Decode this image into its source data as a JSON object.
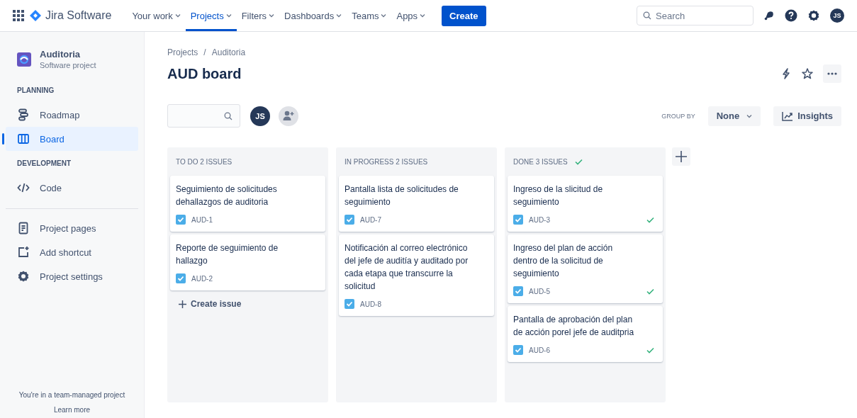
{
  "nav": {
    "app_name": "Jira Software",
    "items": [
      {
        "label": "Your work",
        "selected": false
      },
      {
        "label": "Projects",
        "selected": true
      },
      {
        "label": "Filters",
        "selected": false
      },
      {
        "label": "Dashboards",
        "selected": false
      },
      {
        "label": "Teams",
        "selected": false
      },
      {
        "label": "Apps",
        "selected": false
      }
    ],
    "create_button": "Create",
    "search": {
      "placeholder": "Search"
    },
    "avatar": "JS"
  },
  "sidebar": {
    "project": {
      "name": "Auditoria",
      "subtitle": "Software project"
    },
    "groups": [
      {
        "heading": "PLANNING",
        "items": [
          {
            "label": "Roadmap",
            "selected": false
          },
          {
            "label": "Board",
            "selected": true
          }
        ]
      },
      {
        "heading": "DEVELOPMENT",
        "items": [
          {
            "label": "Code",
            "selected": false
          }
        ]
      },
      {
        "items": [
          {
            "label": "Project pages",
            "selected": false
          },
          {
            "label": "Add shortcut",
            "selected": false
          },
          {
            "label": "Project settings",
            "selected": false
          }
        ]
      }
    ],
    "footer": {
      "text": "You're in a team-managed project",
      "link": "Learn more"
    }
  },
  "board": {
    "breadcrumbs": [
      "Projects",
      "Auditoria"
    ],
    "breadcrumb_separator": "/",
    "title": "AUD board",
    "avatar": "JS",
    "group_by": {
      "label": "GROUP BY",
      "value": "None"
    },
    "insights": "Insights",
    "columns": [
      {
        "title": "TO DO 2 ISSUES",
        "done": false,
        "create_issue": "Create issue",
        "cards": [
          {
            "summary": "Seguimiento de solicitudes dehallazgos de auditoria",
            "key": "AUD-1",
            "resolved": false
          },
          {
            "summary": "Reporte de seguimiento de hallazgo",
            "key": "AUD-2",
            "resolved": false
          }
        ]
      },
      {
        "title": "IN PROGRESS 2 ISSUES",
        "done": false,
        "cards": [
          {
            "summary": "Pantalla lista de solicitudes de seguimiento",
            "key": "AUD-7",
            "resolved": false
          },
          {
            "summary": "Notificación al correo electrónico del jefe de auditía y auditado por cada etapa que transcurre la solicitud",
            "key": "AUD-8",
            "resolved": false
          }
        ]
      },
      {
        "title": "DONE 3 ISSUES",
        "done": true,
        "cards": [
          {
            "summary": "Ingreso de la slicitud de seguimiento",
            "key": "AUD-3",
            "resolved": true
          },
          {
            "summary": "Ingreso del plan de acción dentro de la solicitud de seguimiento",
            "key": "AUD-5",
            "resolved": true
          },
          {
            "summary": "Pantalla de aprobación del plan de acción porel jefe de auditpria",
            "key": "AUD-6",
            "resolved": true
          }
        ]
      }
    ]
  }
}
